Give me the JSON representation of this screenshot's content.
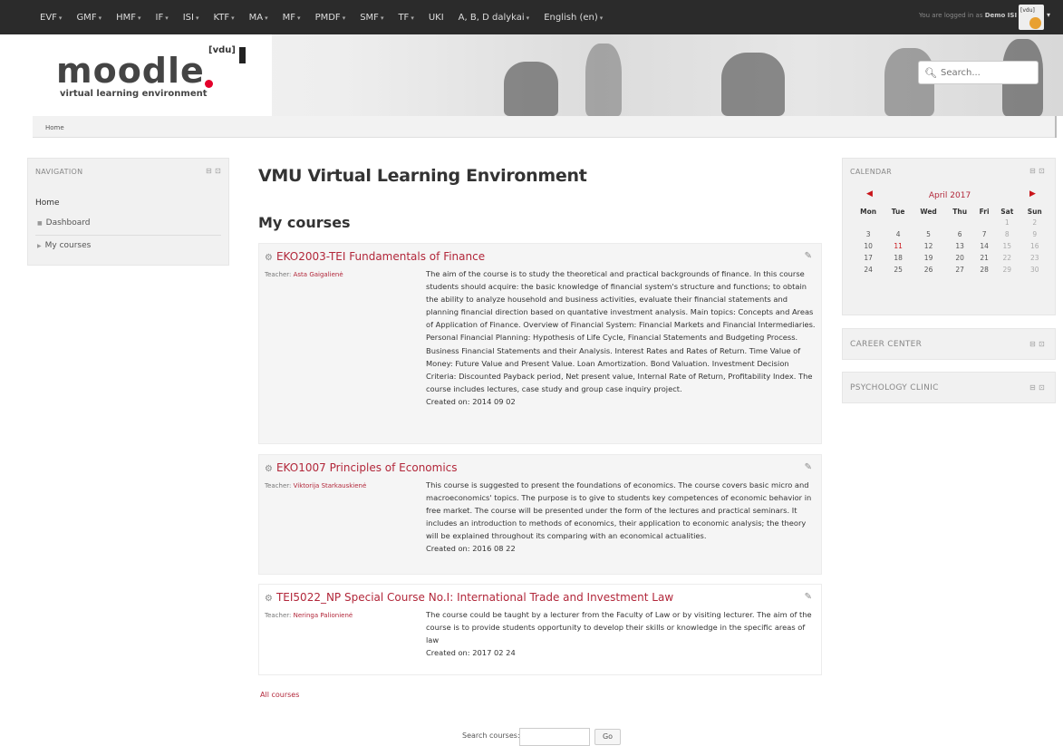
{
  "topnav": {
    "menus": [
      "EVF",
      "GMF",
      "HMF",
      "IF",
      "ISI",
      "KTF",
      "MA",
      "MF",
      "PMDF",
      "SMF",
      "TF",
      "UKI",
      "A, B, D dalykai",
      "English (en)"
    ],
    "dropdown_flags": [
      true,
      true,
      true,
      true,
      true,
      true,
      true,
      true,
      true,
      true,
      true,
      false,
      true,
      true
    ],
    "logged_in_prefix": "You are logged in as",
    "logged_in_user": "Demo ISI",
    "avatar_label": "[vdu]"
  },
  "header": {
    "logo_word": "moodle",
    "logo_badge": "[vdu]",
    "logo_subtitle": "virtual learning environment",
    "search_placeholder": "Search..."
  },
  "breadcrumb": {
    "home": "Home"
  },
  "navigation": {
    "title": "NAVIGATION",
    "home": "Home",
    "dashboard": "Dashboard",
    "my_courses": "My courses"
  },
  "main": {
    "page_title": "VMU Virtual Learning Environment",
    "my_courses_heading": "My courses",
    "courses": [
      {
        "name": "EKO2003-TEI Fundamentals of Finance",
        "teacher_label": "Teacher:",
        "teacher": "Asta Gaigalienė",
        "summary": "The aim of the course is to study the theoretical and practical backgrounds of finance. In this course students should acquire: the basic knowledge of financial system's structure and functions; to obtain the ability to analyze household and business activities, evaluate their financial statements and planning financial direction based on quantative investment analysis. Main topics: Concepts and Areas of Application of Finance. Overview of Financial System: Financial Markets and Financial Intermediaries. Personal Financial Planning: Hypothesis of Life Cycle, Financial Statements and Budgeting Process. Business Financial Statements and their Analysis. Interest Rates and Rates of Return. Time Value of Money: Future Value and Present Value. Loan Amortization. Bond Valuation. Investment Decision Criteria: Discounted Payback period, Net present value, Internal Rate of Return, Profitability Index. The course includes lectures, case study and group case inquiry project.",
        "created": "Created on: 2014 09 02"
      },
      {
        "name": "EKO1007 Principles of Economics",
        "teacher_label": "Teacher:",
        "teacher": "Viktorija Starkauskienė",
        "summary": "This course is suggested to present the foundations of economics. The course covers basic micro and macroeconomics' topics. The purpose is to give to students key competences of economic behavior in free market. The course will be presented under the form of the lectures and practical seminars. It includes an introduction to methods of economics, their application to economic analysis; the theory will be explained throughout its comparing with an economical actualities.",
        "created": "Created on: 2016 08 22"
      },
      {
        "name": "TEI5022_NP Special Course No.I: International Trade and Investment Law",
        "teacher_label": "Teacher:",
        "teacher": "Neringa Palionienė",
        "summary": "The course could be taught by a lecturer from the Faculty of Law or by visiting lecturer. The aim of the course is to provide students opportunity to develop their skills or knowledge in the specific areas of law",
        "created": "Created on: 2017 02 24"
      }
    ],
    "all_courses": "All courses",
    "search_courses_label": "Search courses:",
    "go_label": "Go"
  },
  "calendar": {
    "title": "CALENDAR",
    "month": "April 2017",
    "days": [
      "Mon",
      "Tue",
      "Wed",
      "Thu",
      "Fri",
      "Sat",
      "Sun"
    ],
    "weeks": [
      [
        "",
        "",
        "",
        "",
        "",
        "1",
        "2"
      ],
      [
        "3",
        "4",
        "5",
        "6",
        "7",
        "8",
        "9"
      ],
      [
        "10",
        "11",
        "12",
        "13",
        "14",
        "15",
        "16"
      ],
      [
        "17",
        "18",
        "19",
        "20",
        "21",
        "22",
        "23"
      ],
      [
        "24",
        "25",
        "26",
        "27",
        "28",
        "29",
        "30"
      ]
    ],
    "highlight_day": "11"
  },
  "blocks": {
    "career": "CAREER CENTER",
    "psych": "PSYCHOLOGY CLINIC"
  },
  "colors": {
    "accent": "#b2273a",
    "topbar": "#2b2b2b",
    "logo_dot": "#e4002b"
  }
}
